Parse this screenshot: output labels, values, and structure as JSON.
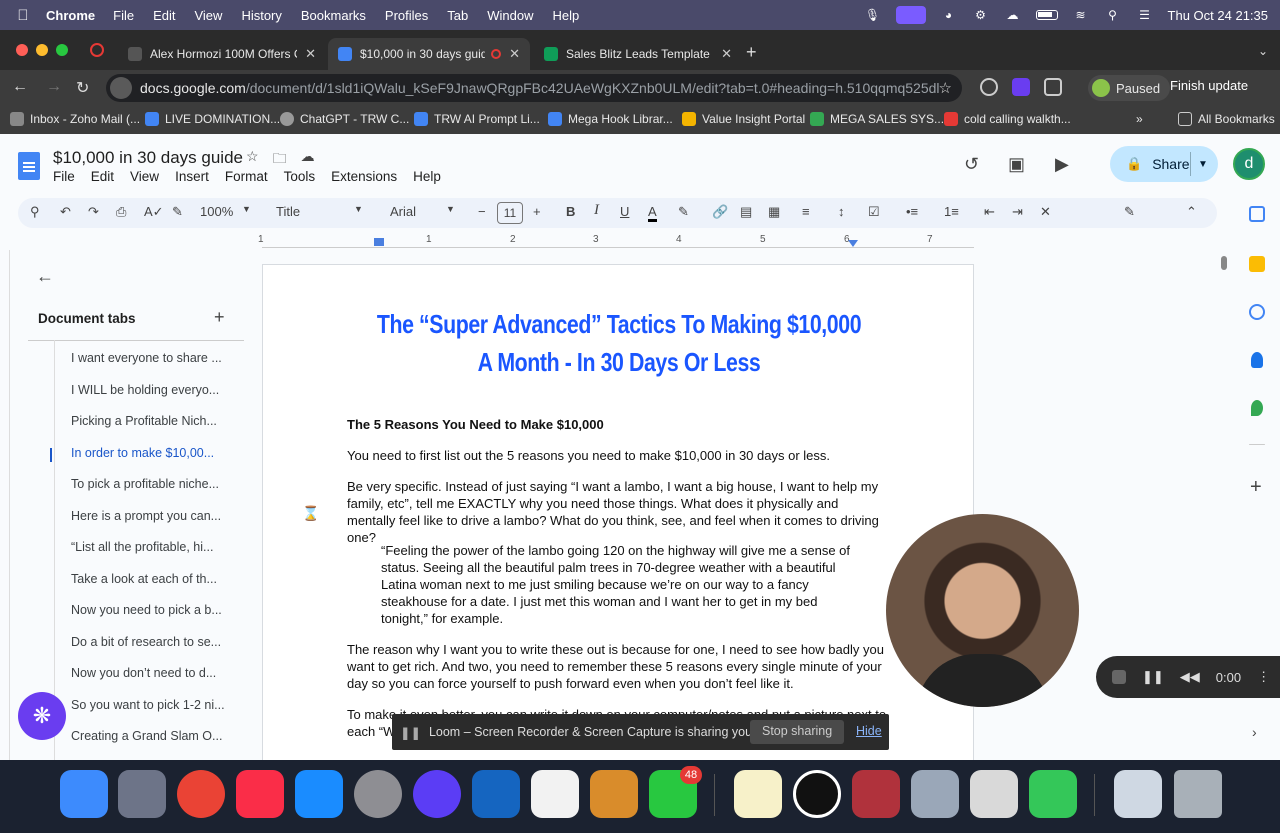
{
  "menubar": {
    "app": "Chrome",
    "items": [
      "File",
      "Edit",
      "View",
      "History",
      "Bookmarks",
      "Profiles",
      "Tab",
      "Window",
      "Help"
    ],
    "clock": "Thu Oct 24  21:35"
  },
  "tabs": [
    {
      "title": "Alex Hormozi 100M Offers Ov",
      "active": false,
      "color": "#444"
    },
    {
      "title": "$10,000 in 30 days guide",
      "active": true,
      "color": "#4285f4"
    },
    {
      "title": "Sales Blitz Leads Template - G",
      "active": false,
      "color": "#0f9d58"
    }
  ],
  "address": {
    "domain": "docs.google.com",
    "path": "/document/d/1sld1iQWalu_kSeF9JnawQRgpFBc42UAeWgKXZnb0ULM/edit?tab=t.0#heading=h.510qqmq525dl",
    "paused": "Paused",
    "finish_update": "Finish update"
  },
  "bookmarks": [
    {
      "label": "Inbox - Zoho Mail (..."
    },
    {
      "label": "LIVE DOMINATION..."
    },
    {
      "label": "ChatGPT - TRW C..."
    },
    {
      "label": "TRW AI Prompt Li..."
    },
    {
      "label": "Mega Hook Librar..."
    },
    {
      "label": "Value Insight Portal"
    },
    {
      "label": "MEGA SALES SYS..."
    },
    {
      "label": "cold calling walkth..."
    },
    {
      "label": "All Bookmarks"
    }
  ],
  "doc": {
    "title": "$10,000 in 30 days guide",
    "menu": [
      "File",
      "Edit",
      "View",
      "Insert",
      "Format",
      "Tools",
      "Extensions",
      "Help"
    ],
    "share": "Share",
    "avatar": "d"
  },
  "toolbar": {
    "zoom": "100%",
    "style": "Title",
    "font": "Arial",
    "size": "11"
  },
  "ruler": [
    "1",
    "1",
    "2",
    "3",
    "4",
    "5",
    "6",
    "7"
  ],
  "sidepanel": {
    "header": "Document tabs",
    "items": [
      "I want everyone to share ...",
      "I WILL be holding everyo...",
      "Picking a Profitable Nich...",
      "In order to make $10,00...",
      "To pick a profitable niche...",
      "Here is a prompt you can...",
      "“List all the profitable, hi...",
      "Take a look at each of th...",
      "Now you need to pick a b...",
      "Do a bit of research to se...",
      "Now you don’t need to d...",
      "So you want to pick 1-2 ni...",
      "Creating a Grand Slam O..."
    ]
  },
  "page": {
    "title1": "The “Super Advanced” Tactics To Making $10,000",
    "title2": "A Month - In 30 Days Or Less",
    "heading": "The 5 Reasons You Need to Make $10,000",
    "p1": "You need to first list out the 5 reasons you need to make $10,000 in 30 days or less.",
    "p2": "Be very specific. Instead of just saying “I want a lambo, I want a big house, I want to help my family, etc”, tell me EXACTLY why you need those things. What does it physically and mentally feel like to drive a lambo? What do you think, see, and feel when it comes to driving one?",
    "quote": "“Feeling the power of the lambo going 120 on the highway will give me a sense of status. Seeing all the beautiful palm trees in 70-degree weather with a beautiful Latina woman next to me just smiling because we’re on our way to a fancy steakhouse for a date. I just met this woman and I want her to get in my bed tonight,” for example.",
    "p3": "The reason why I want you to write these out is because for one, I need to see how badly you want to get rich. And two, you need to remember these 5 reasons every single minute of your day so you can force yourself to push forward even when you don’t feel like it.",
    "p4": "To make it even better, you can write it down on your computer/notes and put a picture next to each “W... whys, yo..."
  },
  "loom": {
    "message": "Loom – Screen Recorder & Screen Capture is sharing your screen.",
    "stop": "Stop sharing",
    "hide": "Hide"
  },
  "recorder": {
    "time": "0:00"
  },
  "dock": {
    "messages_badge": "48"
  }
}
